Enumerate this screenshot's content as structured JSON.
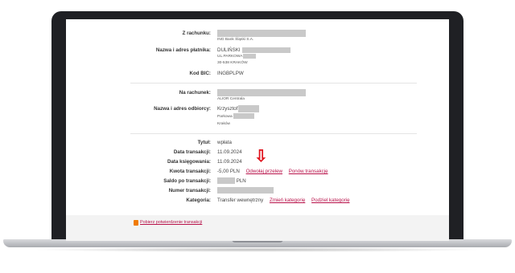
{
  "sender": {
    "account_label": "Z rachunku:",
    "bank_name": "ING Bank Śląski S.A.",
    "payer_label": "Nazwa i adres płatnika:",
    "payer_lines": [
      "DULIŃSKI",
      "UL.PARKOWA",
      "30-538 KRAKÓW"
    ],
    "bic_label": "Kod BIC:",
    "bic_value": "INGBPLPW"
  },
  "recipient": {
    "account_label": "Na rachunek:",
    "bank_name": "ALIOR Centrala",
    "recipient_label": "Nazwa i adres odbiorcy:",
    "recipient_lines": [
      "Krzysztof",
      "Parkowa",
      "Kraków"
    ]
  },
  "transaction": {
    "title_label": "Tytuł:",
    "title_value": "wpłata",
    "date_label": "Data transakcji:",
    "date_value": "11.09.2024",
    "booking_label": "Data księgowania:",
    "booking_value": "11.09.2024",
    "amount_label": "Kwota transakcji:",
    "amount_value": "-5,00 PLN",
    "cancel_link": "Odwołaj przelew",
    "repeat_link": "Ponów transakcję",
    "balance_label": "Saldo po transakcji:",
    "balance_currency": "PLN",
    "number_label": "Numer transakcji:",
    "category_label": "Kategoria:",
    "category_value": "Transfer wewnętrzny",
    "change_category_link": "Zmień kategorię",
    "split_category_link": "Podziel kategorię"
  },
  "footer": {
    "download_link": "Pobierz potwierdzenie transakcji"
  },
  "colors": {
    "link": "#b8124a",
    "arrow": "#e0141e",
    "icon": "#f07b00"
  }
}
